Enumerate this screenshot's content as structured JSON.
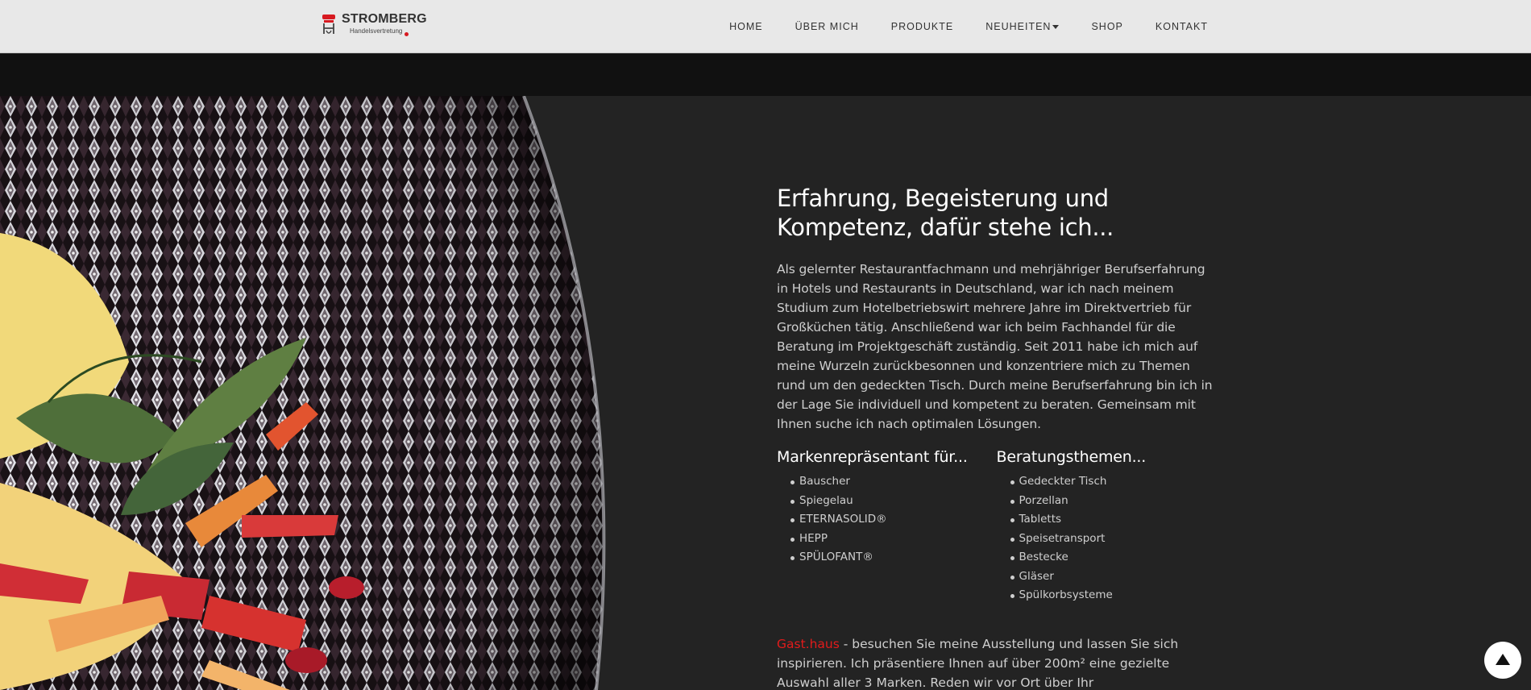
{
  "header": {
    "logo": {
      "title": "STROMBERG",
      "subtitle": "Handelsvertretung"
    },
    "nav": [
      {
        "label": "HOME"
      },
      {
        "label": "ÜBER MICH"
      },
      {
        "label": "PRODUKTE"
      },
      {
        "label": "NEUHEITEN",
        "has_dropdown": true
      },
      {
        "label": "SHOP"
      },
      {
        "label": "KONTAKT"
      }
    ]
  },
  "main": {
    "headline": "Erfahrung, Begeisterung und Kompetenz, dafür stehe ich...",
    "intro": "Als gelernter Restaurantfachmann und mehrjähriger Berufserfahrung in Hotels und Restaurants in Deutschland, war ich nach meinem Studium zum Hotelbetriebswirt mehrere Jahre im Direktvertrieb für Großküchen tätig. Anschließend war ich beim Fachhandel für die Beratung im Projektgeschäft zuständig. Seit 2011 habe ich mich auf meine Wurzeln zurückbesonnen und konzentriere mich zu Themen rund um den gedeckten Tisch. Durch meine Berufserfahrung bin ich in der Lage Sie individuell und kompetent zu beraten. Gemeinsam mit Ihnen suche ich nach optimalen Lösungen.",
    "brands": {
      "title": "Markenrepräsentant für...",
      "items": [
        "Bauscher",
        "Spiegelau",
        "ETERNASOLID®",
        "HEPP",
        "SPÜLOFANT®"
      ]
    },
    "topics": {
      "title": "Beratungsthemen...",
      "items": [
        "Gedeckter Tisch",
        "Porzellan",
        "Tabletts",
        "Speisetransport",
        "Bestecke",
        "Gläser",
        "Spülkorbsysteme"
      ]
    },
    "gast": {
      "link": "Gast.haus",
      "text": " - besuchen Sie meine Ausstellung und lassen Sie sich inspirieren. Ich präsentiere Ihnen auf über 200m² eine gezielte Auswahl aller 3 Marken. Reden wir vor Ort über Ihr Gastronomiekonzept, denn der"
    }
  },
  "colors": {
    "header_bg": "#e8e8e8",
    "band_bg": "#111111",
    "page_bg": "#232323",
    "accent": "#e21b1b"
  },
  "icons": {
    "logo": "chair-logo-icon",
    "scroll_top": "arrow-up-icon"
  }
}
